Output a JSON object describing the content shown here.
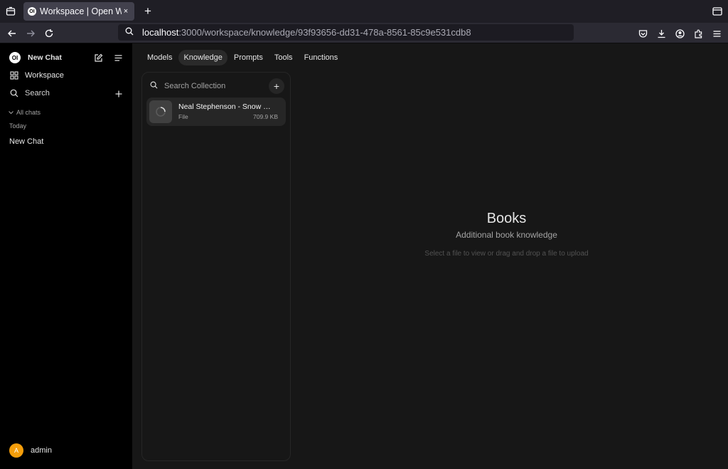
{
  "browser": {
    "tab_title": "Workspace | Open WebUI",
    "tab_close": "×",
    "new_tab": "+",
    "url_host": "localhost",
    "url_path": ":3000/workspace/knowledge/93f93656-dd31-478a-8561-85c9e531cdb8"
  },
  "sidebar": {
    "logo_text": "OI",
    "new_chat": "New Chat",
    "workspace": "Workspace",
    "search": "Search",
    "all_chats": "All chats",
    "group_today": "Today",
    "chats": [
      "New Chat"
    ],
    "user_initial": "A",
    "user_name": "admin"
  },
  "workspace": {
    "tabs": [
      "Models",
      "Knowledge",
      "Prompts",
      "Tools",
      "Functions"
    ],
    "active_tab": "Knowledge"
  },
  "collection": {
    "search_placeholder": "Search Collection",
    "add_label": "+",
    "files": [
      {
        "name": "Neal Stephenson - Snow Crash",
        "type": "File",
        "size": "709.9 KB"
      }
    ]
  },
  "knowledge": {
    "title": "Books",
    "description": "Additional book knowledge",
    "hint": "Select a file to view or drag and drop a file to upload"
  },
  "colors": {
    "sidebar_bg": "#000000",
    "main_bg": "#171717",
    "avatar": "#f59e0b"
  }
}
